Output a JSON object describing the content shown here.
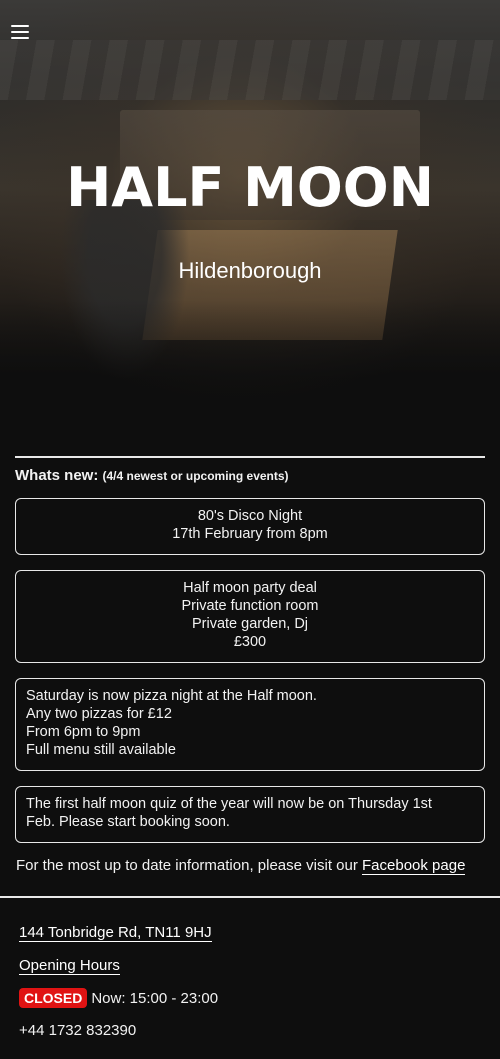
{
  "header": {
    "menu_icon": "hamburger-menu-icon"
  },
  "hero": {
    "title": "HALF MOON",
    "subtitle": "Hildenborough"
  },
  "news": {
    "heading": "Whats new:",
    "heading_sub": "(4/4 newest or upcoming events)",
    "items": [
      {
        "lines": [
          "80's Disco Night",
          "17th February from 8pm"
        ]
      },
      {
        "lines": [
          "Half moon party deal",
          "Private function room",
          "Private garden, Dj",
          "£300"
        ]
      },
      {
        "lines": [
          "Saturday is now pizza night at the Half moon.",
          "Any two pizzas for £12",
          "From 6pm to 9pm",
          "Full menu still available"
        ]
      },
      {
        "lines": [
          "The first half moon quiz of the year will now be on Thursday 1st",
          "Feb. Please start booking soon."
        ]
      }
    ],
    "footnote_text": "For the most up to date information, please visit our ",
    "footnote_link": "Facebook page"
  },
  "footer": {
    "address": "144 Tonbridge Rd, TN11 9HJ",
    "opening_hours": "Opening Hours",
    "status_badge": "CLOSED",
    "status_text": "Now: 15:00 - 23:00",
    "phone": "+44 1732 832390"
  },
  "colors": {
    "badge": "#e01313",
    "background": "#0e0e0e"
  }
}
